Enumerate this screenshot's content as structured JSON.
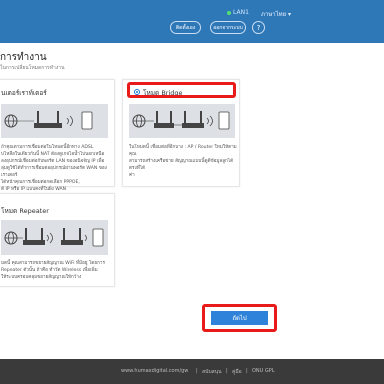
{
  "header": {
    "wan_label": "LAN1",
    "language": "ภาษาไทย ▾",
    "button1": "ติดตั้งเอง",
    "button2": "ออกจากระบบ",
    "help": "?"
  },
  "page": {
    "title": "การทำงาน",
    "subtitle": "ในการเปลี่ยนโหมดการทำงาน"
  },
  "cards": {
    "router": {
      "title": "นเตอร์เราท์เตอร์",
      "desc_lines": [
        "ถ้าคุณตามการเชื่อมต่อในโหมดนี้อีกทาง ADSL",
        "บไหลือในเดียวกันนี้ NAT ต้องดูเกจไอน้ำไปนอกเหนือ",
        "ลงอุปกรณ์เชื่อมต่อกับพอร์ต LAN ของอนิจจัญ IP เพื่อ",
        "ลุ่มดูใช้ได้ทำการเชื่อมต่ออุปกรณ์ผ่านพอร์ต WAN ของเราเตอร์",
        "ได้หน้าคุณการเชื่อมต่อกดเลือก PPPOE,",
        "ต์ IP หรือ IP แบบคงที่ในฝั่ง WAN"
      ]
    },
    "bridge": {
      "title": "โหมด Bridge",
      "desc_lines": [
        "ในโหมดนี้ เชื่อมต่อที่อีกบาง : AP / Router ใหม่ให้ตาม คุณ",
        "สามารถสร้างเครือข่าย สัญญาณแบบนี้ดูดีข้อมูลลูกได้ตรงที่ได้",
        "ค่า"
      ]
    },
    "repeater": {
      "title": "โหมด Repeater",
      "desc_lines": [
        "มดนี้ คุณสามารถขยายสัญญาณ WiFi ที่มีอยู่ โดยการ",
        "Repeater ตัวนั้น ถ้าคือ ทำวัด Wireless เพื่อเพิ่ม",
        "ให้ระบบครอบคลุมขยายสัญญาณให้กว้าง"
      ]
    }
  },
  "actions": {
    "next": "ถัดไป"
  },
  "footer": {
    "site": "www.humaxdigital.com/gw",
    "link1": "สนับสนุน",
    "link2": "คู่มือ",
    "link3": "ONU GPL"
  },
  "colors": {
    "header_bg": "#2f78b8",
    "accent": "#2f82d9",
    "highlight": "#e81a1a"
  }
}
